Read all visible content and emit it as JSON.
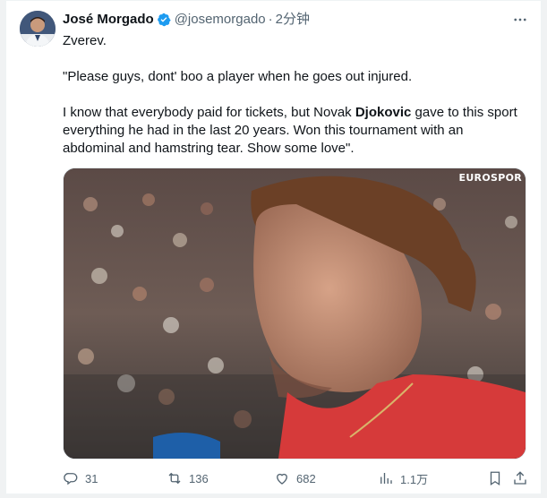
{
  "author": {
    "name": "José Morgado",
    "handle": "@josemorgado",
    "separator": "·",
    "time": "2分钟",
    "verified": true
  },
  "tweet": {
    "line1": "Zverev.",
    "quote_intro": "\"Please guys, dont' boo a player when he goes out injured.",
    "para2_before": "I know that everybody paid for tickets, but Novak ",
    "para2_bold": "Djokovic",
    "para2_after": " gave to this sport everything he had in the last 20 years. Won this tournament with an abdominal and hamstring tear. Show some love\"."
  },
  "media": {
    "watermark": "EUROSPOR",
    "description_icon": "photo-icon"
  },
  "actions": {
    "replies": "31",
    "retweets": "136",
    "likes": "682",
    "views": "1.1万"
  },
  "colors": {
    "accent": "#1d9bf0",
    "muted": "#536471",
    "text": "#0f1419",
    "shirt": "#d63a3a"
  }
}
